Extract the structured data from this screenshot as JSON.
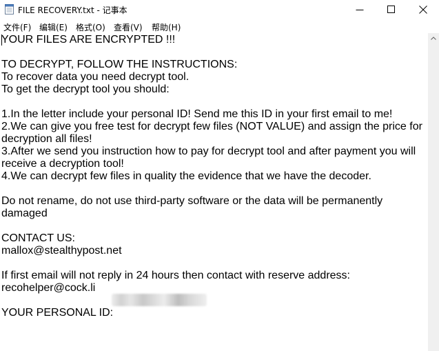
{
  "window": {
    "title": "FILE RECOVERY.txt - 记事本",
    "icon": "notepad-icon"
  },
  "menu": [
    {
      "label": "文件(F)"
    },
    {
      "label": "编辑(E)"
    },
    {
      "label": "格式(O)"
    },
    {
      "label": "查看(V)"
    },
    {
      "label": "帮助(H)"
    }
  ],
  "document": {
    "text": "YOUR FILES ARE ENCRYPTED !!!\n\nTO DECRYPT, FOLLOW THE INSTRUCTIONS:\nTo recover data you need decrypt tool.\nTo get the decrypt tool you should:\n\n1.In the letter include your personal ID! Send me this ID in your first email to me!\n2.We can give you free test for decrypt few files (NOT VALUE) and assign the price for decryption all files!\n3.After we send you instruction how to pay for decrypt tool and after payment you will receive a decryption tool!\n4.We can decrypt few files in quality the evidence that we have the decoder.\n\nDo not rename, do not use third-party software or the data will be permanently damaged\n\nCONTACT US:\nmallox@stealthypost.net\n\nIf first email will not reply in 24 hours then contact with reserve address:\nrecohelper@cock.li\n\nYOUR PERSONAL ID: "
  }
}
